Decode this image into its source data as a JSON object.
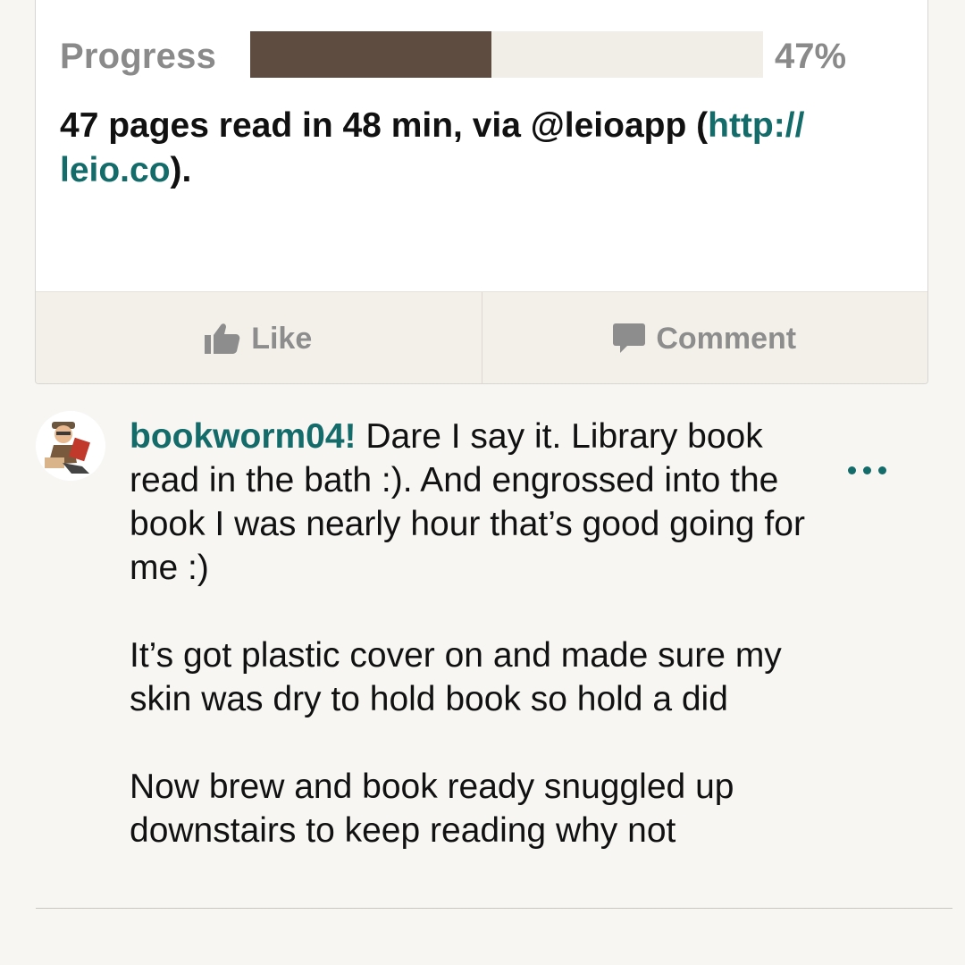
{
  "update": {
    "progress_label": "Progress",
    "progress_value": 0.47,
    "progress_percent": "47%",
    "text_prefix": "47 pages read in 48 min, via @leioapp (",
    "link_text": "http://leio.co",
    "text_suffix": ")."
  },
  "actions": {
    "like_label": "Like",
    "comment_label": "Comment"
  },
  "comment": {
    "username": "bookworm04!",
    "paragraphs": [
      " Dare I say it. Library book read in the bath :). And engrossed into the book I was nearly hour that’s good going for me :)",
      "It’s got plastic cover on and made sure my skin was dry to hold book so hold a did",
      "Now brew and book ready snuggled up downstairs to keep reading why not"
    ]
  },
  "colors": {
    "accent": "#136b6a",
    "progress_fill": "#5f4c40",
    "progress_track": "#f1eee8",
    "background": "#f7f6f3",
    "action_bar": "#f3f0ea"
  },
  "icons": {
    "like": "thumbs-up-icon",
    "comment": "speech-bubble-icon",
    "more": "more-dots-icon",
    "avatar": "cartoon-reader-avatar"
  }
}
